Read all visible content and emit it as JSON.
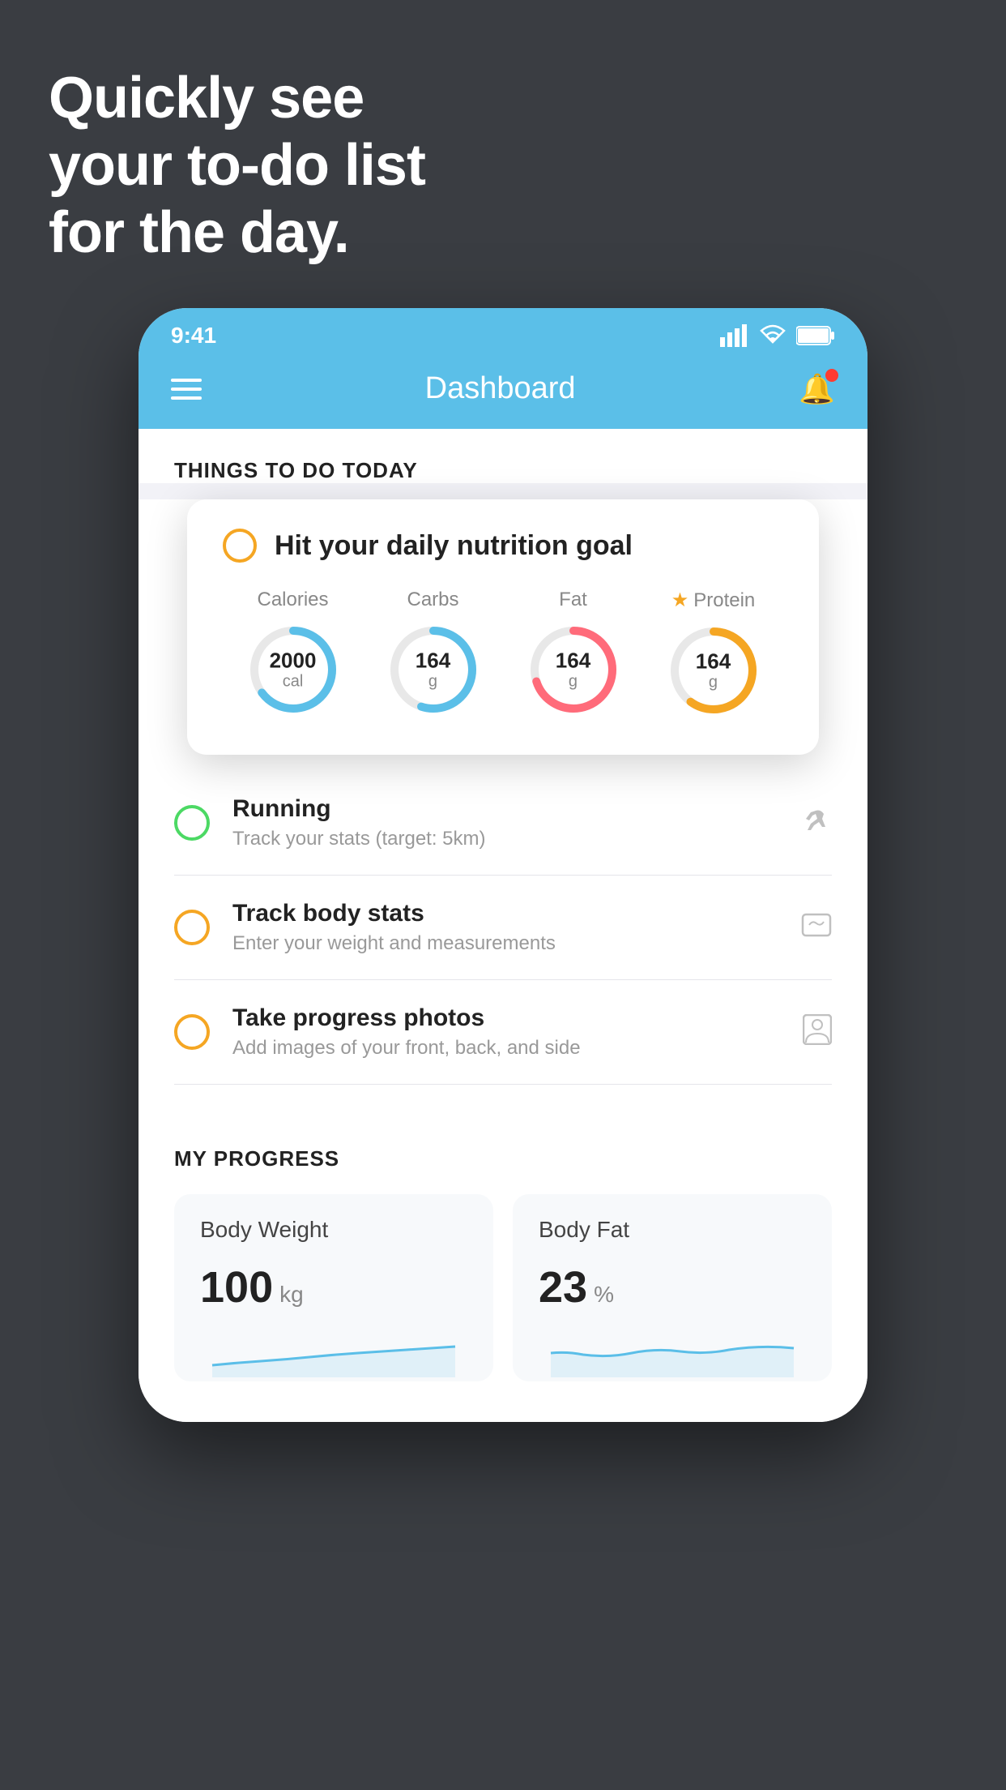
{
  "hero": {
    "line1": "Quickly see",
    "line2": "your to-do list",
    "line3": "for the day."
  },
  "status_bar": {
    "time": "9:41"
  },
  "nav": {
    "title": "Dashboard"
  },
  "things_section": {
    "title": "THINGS TO DO TODAY"
  },
  "nutrition_card": {
    "title": "Hit your daily nutrition goal",
    "items": [
      {
        "label": "Calories",
        "value": "2000",
        "unit": "cal",
        "color": "#5bbfe8",
        "pct": 65
      },
      {
        "label": "Carbs",
        "value": "164",
        "unit": "g",
        "color": "#5bbfe8",
        "pct": 55
      },
      {
        "label": "Fat",
        "value": "164",
        "unit": "g",
        "color": "#ff6b7a",
        "pct": 70
      },
      {
        "label": "Protein",
        "value": "164",
        "unit": "g",
        "color": "#f5a623",
        "pct": 60,
        "starred": true
      }
    ]
  },
  "todo_items": [
    {
      "title": "Running",
      "subtitle": "Track your stats (target: 5km)",
      "icon": "🏃",
      "checked": true,
      "color": "green"
    },
    {
      "title": "Track body stats",
      "subtitle": "Enter your weight and measurements",
      "icon": "⚖️",
      "checked": false,
      "color": "yellow"
    },
    {
      "title": "Take progress photos",
      "subtitle": "Add images of your front, back, and side",
      "icon": "👤",
      "checked": false,
      "color": "yellow"
    }
  ],
  "progress_section": {
    "title": "MY PROGRESS",
    "cards": [
      {
        "title": "Body Weight",
        "value": "100",
        "unit": "kg"
      },
      {
        "title": "Body Fat",
        "value": "23",
        "unit": "%"
      }
    ]
  }
}
